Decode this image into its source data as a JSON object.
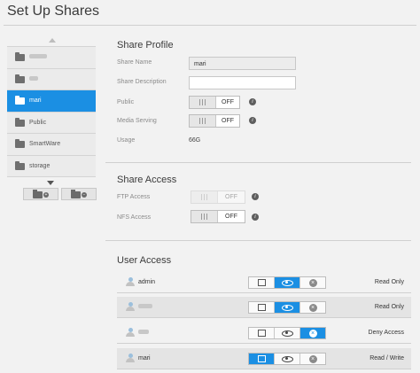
{
  "header": {
    "title": "Set Up Shares"
  },
  "shares": [
    {
      "label": "",
      "obscured": true
    },
    {
      "label": "",
      "obscured": true
    },
    {
      "label": "mari",
      "selected": true
    },
    {
      "label": "Public"
    },
    {
      "label": "SmartWare"
    },
    {
      "label": "storage"
    }
  ],
  "share_profile": {
    "heading": "Share Profile",
    "name_label": "Share Name",
    "name_value": "mari",
    "description_label": "Share Description",
    "description_value": "",
    "public_label": "Public",
    "public_state": "OFF",
    "media_label": "Media Serving",
    "media_state": "OFF",
    "usage_label": "Usage",
    "usage_value": "66G"
  },
  "share_access": {
    "heading": "Share Access",
    "ftp_label": "FTP Access",
    "ftp_state": "OFF",
    "nfs_label": "NFS Access",
    "nfs_state": "OFF"
  },
  "user_access": {
    "heading": "User Access",
    "users": [
      {
        "name": "admin",
        "obscured": false,
        "active": "read",
        "permission": "Read Only"
      },
      {
        "name": "",
        "obscured": true,
        "active": "read",
        "permission": "Read Only"
      },
      {
        "name": "",
        "obscured": true,
        "active": "deny",
        "permission": "Deny Access"
      },
      {
        "name": "mari",
        "obscured": false,
        "active": "write",
        "permission": "Read / Write"
      }
    ]
  },
  "colors": {
    "accent": "#1b8fe3",
    "background": "#f2f2f2"
  },
  "icons": {
    "folder": "folder-icon",
    "user": "user-icon",
    "info": "info-icon",
    "edit": "edit-icon",
    "read": "eye-icon",
    "deny": "x-circle-icon"
  }
}
